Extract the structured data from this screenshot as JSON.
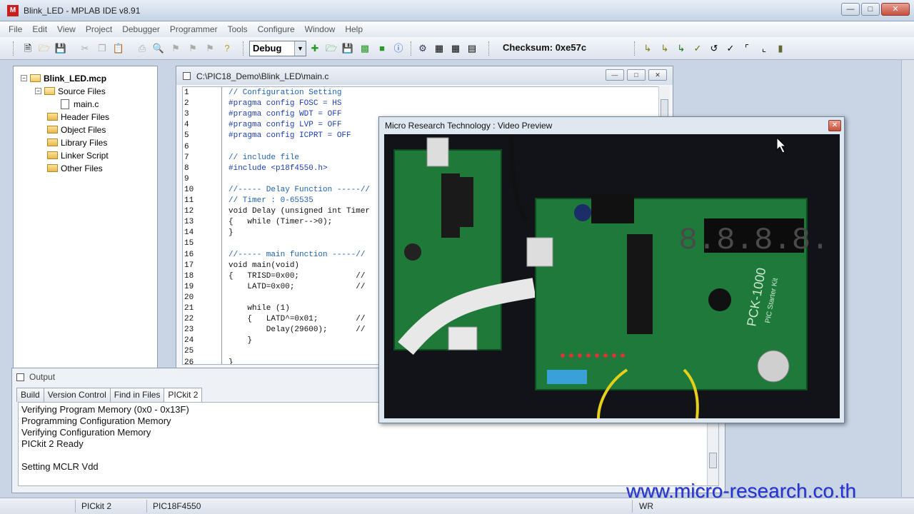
{
  "window": {
    "title": "Blink_LED - MPLAB IDE v8.91",
    "app_icon": "mplab-icon"
  },
  "menu": [
    "File",
    "Edit",
    "View",
    "Project",
    "Debugger",
    "Programmer",
    "Tools",
    "Configure",
    "Window",
    "Help"
  ],
  "toolbar": {
    "config_value": "Debug",
    "checksum": "Checksum:  0xe57c"
  },
  "project": {
    "root": "Blink_LED.mcp",
    "folders": [
      {
        "label": "Source Files",
        "children": [
          "main.c"
        ]
      },
      {
        "label": "Header Files"
      },
      {
        "label": "Object Files"
      },
      {
        "label": "Library Files"
      },
      {
        "label": "Linker Script"
      },
      {
        "label": "Other Files"
      }
    ]
  },
  "editor": {
    "title": "C:\\PIC18_Demo\\Blink_LED\\main.c",
    "lines": [
      {
        "n": "1",
        "code": "// Configuration Setting"
      },
      {
        "n": "2",
        "code": "#pragma config FOSC = HS"
      },
      {
        "n": "3",
        "code": "#pragma config WDT = OFF"
      },
      {
        "n": "4",
        "code": "#pragma config LVP = OFF"
      },
      {
        "n": "5",
        "code": "#pragma config ICPRT = OFF"
      },
      {
        "n": "6",
        "code": ""
      },
      {
        "n": "7",
        "code": "// include file"
      },
      {
        "n": "8",
        "code": "#include <p18f4550.h>"
      },
      {
        "n": "9",
        "code": ""
      },
      {
        "n": "10",
        "code": "//----- Delay Function -----//"
      },
      {
        "n": "11",
        "code": "// Timer : 0-65535"
      },
      {
        "n": "12",
        "code": "void Delay (unsigned int Timer"
      },
      {
        "n": "13",
        "code": "{   while (Timer-->0);"
      },
      {
        "n": "14",
        "code": "}"
      },
      {
        "n": "15",
        "code": ""
      },
      {
        "n": "16",
        "code": "//----- main function -----//"
      },
      {
        "n": "17",
        "code": "void main(void)"
      },
      {
        "n": "18",
        "code": "{   TRISD=0x00;            //"
      },
      {
        "n": "19",
        "code": "    LATD=0x00;             //"
      },
      {
        "n": "20",
        "code": ""
      },
      {
        "n": "21",
        "code": "    while (1)"
      },
      {
        "n": "22",
        "code": "    {   LATD^=0x01;        //"
      },
      {
        "n": "23",
        "code": "        Delay(29600);      //"
      },
      {
        "n": "24",
        "code": "    }"
      },
      {
        "n": "25",
        "code": ""
      },
      {
        "n": "26",
        "code": "}"
      }
    ]
  },
  "output": {
    "title": "Output",
    "tabs": [
      "Build",
      "Version Control",
      "Find in Files",
      "PICkit 2"
    ],
    "active_tab": "PICkit 2",
    "lines": [
      "Verifying Program Memory (0x0 - 0x13F)",
      "Programming Configuration Memory",
      "Verifying Configuration Memory",
      "PICkit 2 Ready",
      "",
      "Setting MCLR Vdd"
    ]
  },
  "status": {
    "programmer": "PICkit 2",
    "device": "PIC18F4550",
    "mode": "WR"
  },
  "video": {
    "title": "Micro Research Technology : Video Preview",
    "board_label": "PCK-1000",
    "board_sublabel": "PIC Starter Kit",
    "display": "8.8.8.8."
  },
  "watermark": "www.micro-research.co.th"
}
